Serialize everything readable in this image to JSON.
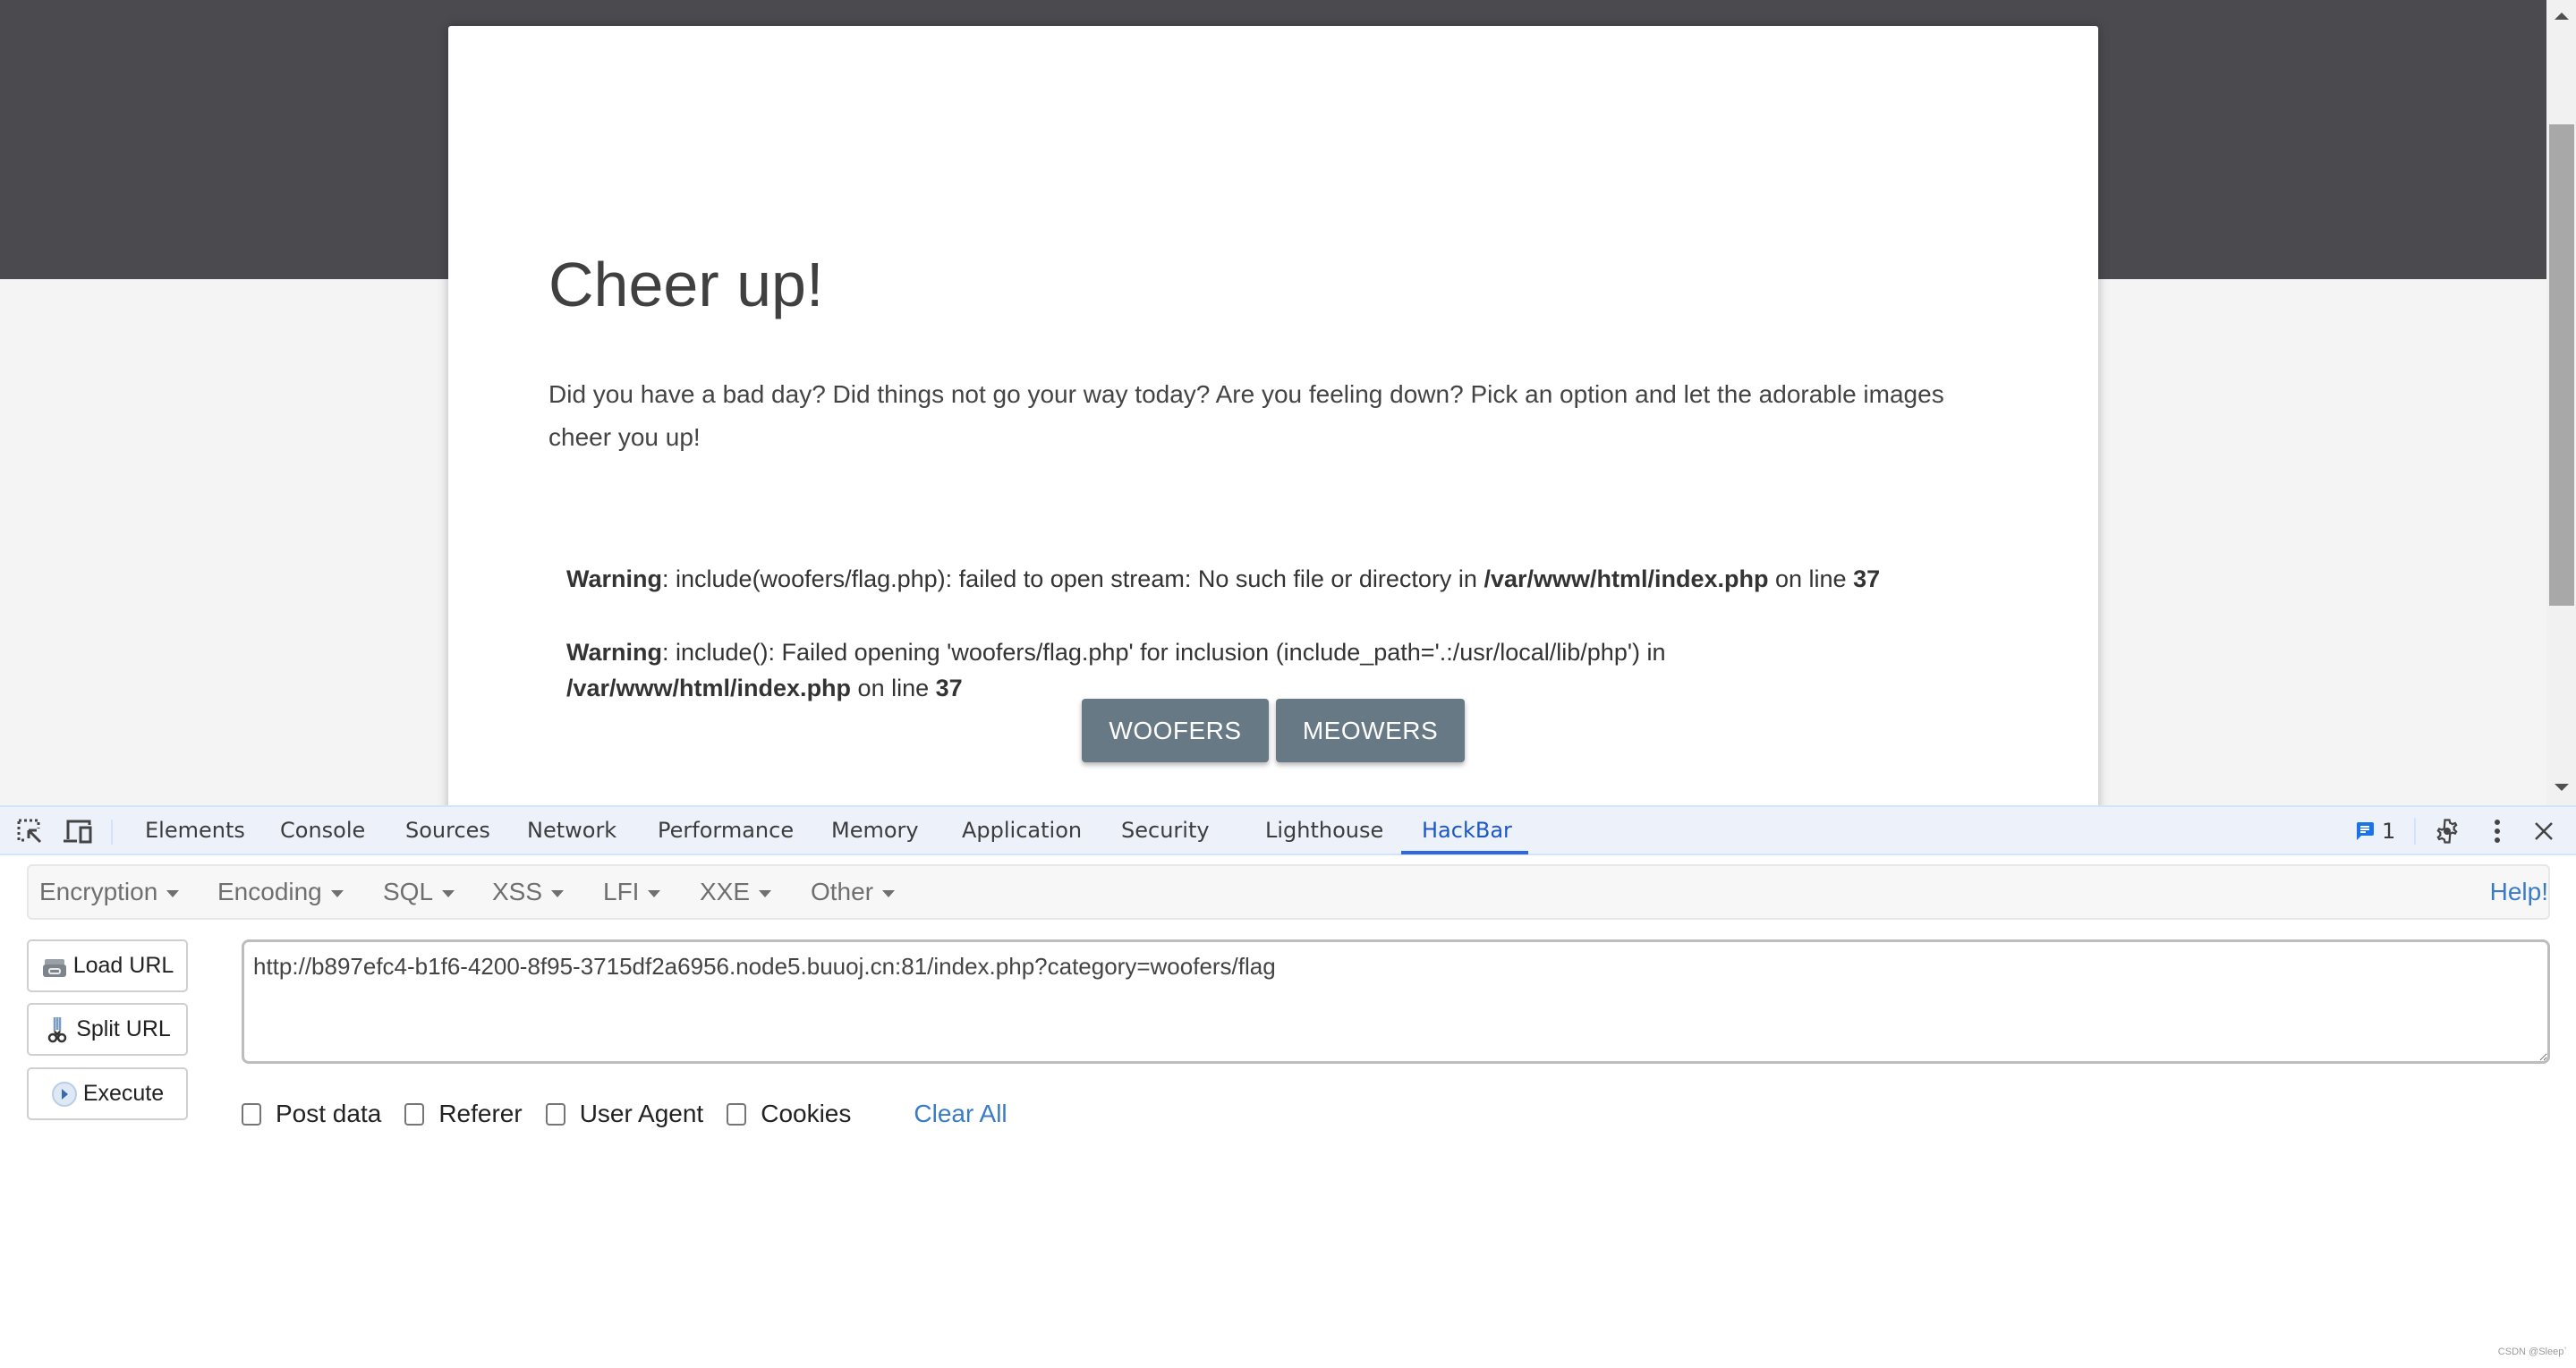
{
  "page": {
    "title": "Cheer up!",
    "intro": "Did you have a bad day? Did things not go your way today? Are you feeling down? Pick an option and let the adorable images cheer you up!",
    "warnings": [
      {
        "label": "Warning",
        "message": ": include(woofers/flag.php): failed to open stream: No such file or directory in ",
        "file": "/var/www/html/index.php",
        "on_line": " on line ",
        "line": "37"
      },
      {
        "label": "Warning",
        "message": ": include(): Failed opening 'woofers/flag.php' for inclusion (include_path='.:/usr/local/lib/php') in ",
        "file": "/var/www/html/index.php",
        "on_line": " on line ",
        "line": "37"
      }
    ],
    "buttons": {
      "woofers": "WOOFERS",
      "meowers": "MEOWERS"
    },
    "colors": {
      "band": "#4a4a4f",
      "background": "#f4f4f4",
      "button": "#677985"
    }
  },
  "devtools": {
    "icons": {
      "inspect": "inspect-element-icon",
      "device": "device-toolbar-icon",
      "issues": "issues-message-icon",
      "settings": "gear-icon",
      "more": "more-vertical-icon",
      "close": "close-icon"
    },
    "tabs": [
      {
        "label": "Elements",
        "active": false
      },
      {
        "label": "Console",
        "active": false
      },
      {
        "label": "Sources",
        "active": false
      },
      {
        "label": "Network",
        "active": false
      },
      {
        "label": "Performance",
        "active": false
      },
      {
        "label": "Memory",
        "active": false
      },
      {
        "label": "Application",
        "active": false
      },
      {
        "label": "Security",
        "active": false
      },
      {
        "label": "Lighthouse",
        "active": false
      },
      {
        "label": "HackBar",
        "active": true
      }
    ],
    "issues_count": "1",
    "accent": "#1a57c8"
  },
  "hackbar": {
    "menus": [
      {
        "label": "Encryption"
      },
      {
        "label": "Encoding"
      },
      {
        "label": "SQL"
      },
      {
        "label": "XSS"
      },
      {
        "label": "LFI"
      },
      {
        "label": "XXE"
      },
      {
        "label": "Other"
      }
    ],
    "help": "Help!",
    "buttons": {
      "load_url": "Load URL",
      "split_url": "Split URL",
      "execute": "Execute"
    },
    "url": "http://b897efc4-b1f6-4200-8f95-3715df2a6956.node5.buuoj.cn:81/index.php?category=woofers/flag",
    "options": [
      {
        "label": "Post data",
        "checked": false
      },
      {
        "label": "Referer",
        "checked": false
      },
      {
        "label": "User Agent",
        "checked": false
      },
      {
        "label": "Cookies",
        "checked": false
      }
    ],
    "clear_all": "Clear All",
    "link_color": "#3a7bc8"
  },
  "watermark": "CSDN @Sleep`"
}
